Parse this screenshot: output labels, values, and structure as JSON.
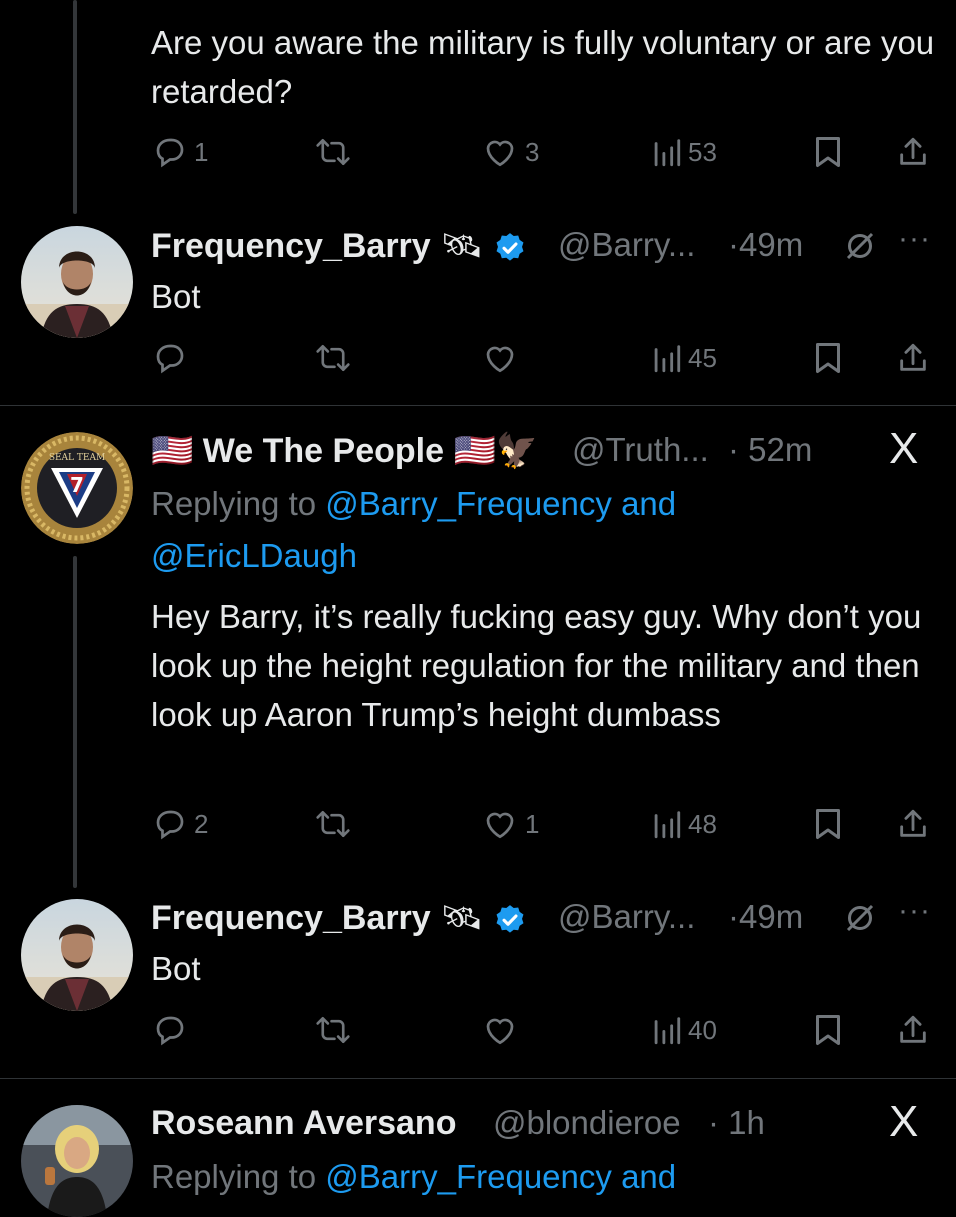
{
  "tweet1": {
    "text": "Are you aware the military is fully voluntary or are you retarded?",
    "replies": "1",
    "retweets": "",
    "likes": "3",
    "views": "53"
  },
  "reply1": {
    "name": "Frequency_Barry",
    "name_emoji": "🛰",
    "handle": "@Barry...",
    "time": "·49m",
    "text": "Bot",
    "replies": "",
    "retweets": "",
    "likes": "",
    "views": "45"
  },
  "tweet2": {
    "flag_left": "🇺🇸",
    "name": "We The People",
    "flag_right": "🇺🇸🦅",
    "handle": "@Truth...",
    "time": "· 52m",
    "replying_prefix": "Replying to",
    "replying_mention1": "@Barry_Frequency",
    "replying_and": "and",
    "replying_mention2": "@EricLDaugh",
    "text": "Hey Barry, it’s really fucking easy guy. Why don’t you look up the height regulation for the military and then look up Aaron Trump’s height dumbass",
    "replies": "2",
    "retweets": "",
    "likes": "1",
    "views": "48",
    "badge_text": "SEAL TEAM",
    "badge_number": "7"
  },
  "reply2": {
    "name": "Frequency_Barry",
    "name_emoji": "🛰",
    "handle": "@Barry...",
    "time": "·49m",
    "text": "Bot",
    "replies": "",
    "retweets": "",
    "likes": "",
    "views": "40"
  },
  "tweet3": {
    "name": "Roseann Aversano",
    "handle": "@blondieroe",
    "time": "· 1h",
    "replying_prefix": "Replying to",
    "replying_mention1": "@Barry_Frequency",
    "replying_and": "and"
  },
  "x_logo": "X",
  "colors": {
    "background": "#000000",
    "text": "#e7e9ea",
    "muted": "#71767b",
    "link": "#1d9bf0",
    "verified": "#1d9bf0",
    "divider": "#2f3336"
  }
}
